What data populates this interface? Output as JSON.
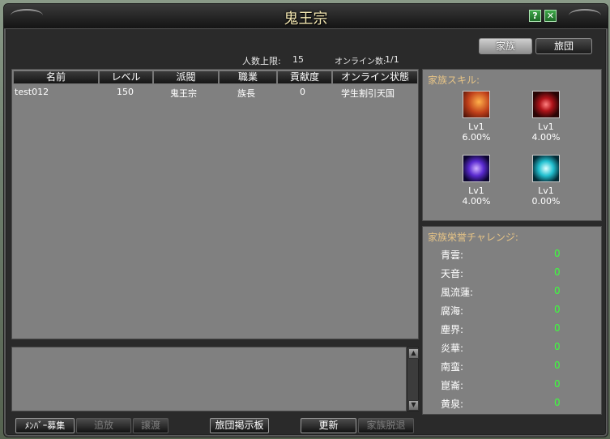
{
  "window": {
    "title": "鬼王宗",
    "help_icon": "question-icon",
    "close_icon": "close-x-icon"
  },
  "tabs": [
    {
      "label": "家族",
      "active": true
    },
    {
      "label": "旅団",
      "active": false
    }
  ],
  "stats": {
    "max_members_label": "人数上限:",
    "max_members": "15",
    "online_label": "オンライン数:",
    "online": "1/1"
  },
  "columns": [
    "名前",
    "レベル",
    "派閥",
    "職業",
    "貢献度",
    "オンライン状態"
  ],
  "members": [
    {
      "name": "test012",
      "level": "150",
      "faction": "鬼王宗",
      "job": "族長",
      "contribution": "0",
      "status": "学生割引天国"
    }
  ],
  "skills_panel": {
    "title": "家族スキル:",
    "skills": [
      {
        "level": "Lv1",
        "rate": "6.00%",
        "icon": "fire-claw-icon",
        "color": "#c0401a"
      },
      {
        "level": "Lv1",
        "rate": "4.00%",
        "icon": "red-orb-icon",
        "color": "#b0141a"
      },
      {
        "level": "Lv1",
        "rate": "4.00%",
        "icon": "purple-orb-icon",
        "color": "#5a2ad0"
      },
      {
        "level": "Lv1",
        "rate": "0.00%",
        "icon": "cyan-orb-icon",
        "color": "#22c0d0"
      }
    ]
  },
  "honor_panel": {
    "title": "家族栄誉チャレンジ:",
    "items": [
      {
        "name": "青雲:",
        "value": "0"
      },
      {
        "name": "天音:",
        "value": "0"
      },
      {
        "name": "風流蓮:",
        "value": "0"
      },
      {
        "name": "腐海:",
        "value": "0"
      },
      {
        "name": "塵界:",
        "value": "0"
      },
      {
        "name": "炎華:",
        "value": "0"
      },
      {
        "name": "南蛮:",
        "value": "0"
      },
      {
        "name": "崑崙:",
        "value": "0"
      },
      {
        "name": "黄泉:",
        "value": "0"
      }
    ]
  },
  "buttons": {
    "recruit": "ﾒﾝﾊﾞｰ募集",
    "expel": "追放",
    "transfer": "譲渡",
    "board": "旅団掲示板",
    "refresh": "更新",
    "leave": "家族脱退"
  },
  "scroll_icons": {
    "up": "arrow-up-icon",
    "down": "arrow-down-icon"
  }
}
